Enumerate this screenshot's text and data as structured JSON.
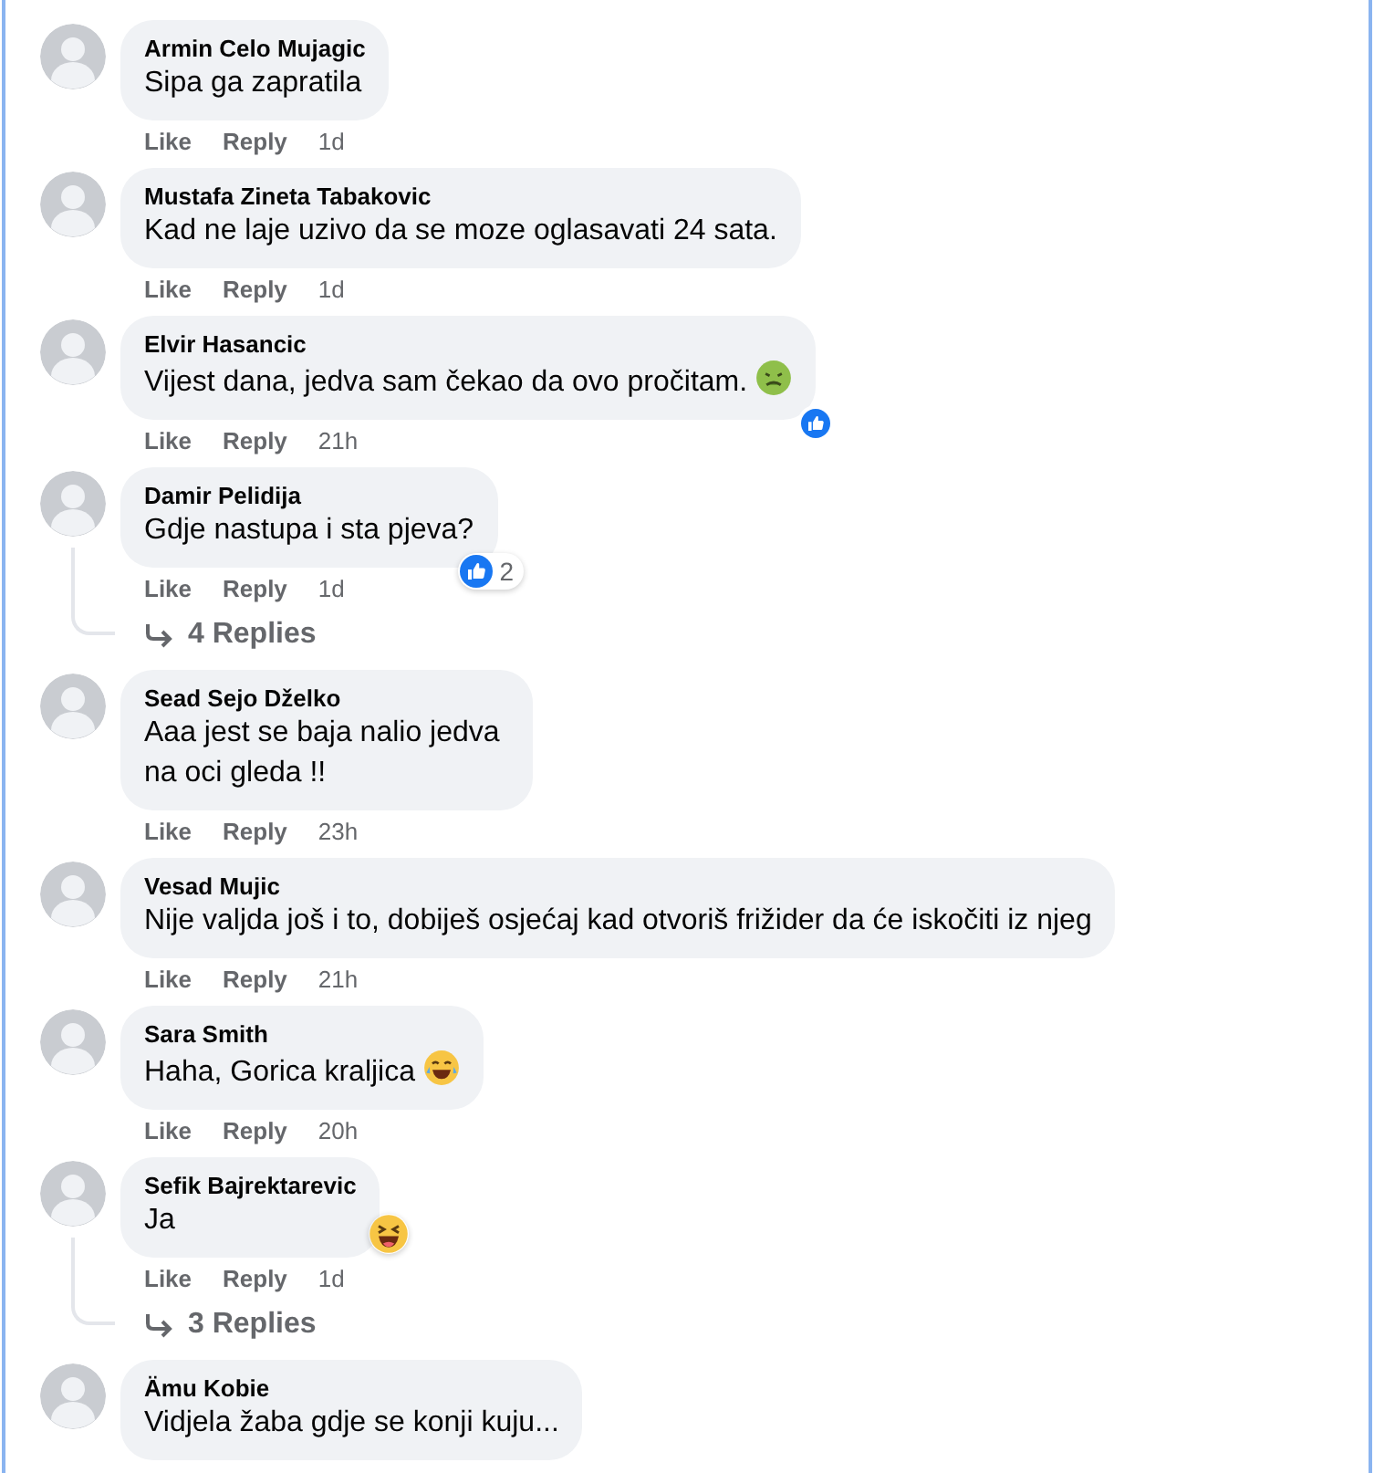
{
  "comments": [
    {
      "author": "Armin Celo Mujagic",
      "text": "Sipa ga zapratila",
      "actions": [
        "Like",
        "Reply"
      ],
      "time": "1d"
    },
    {
      "author": "Mustafa Zineta Tabakovic",
      "text": "Kad ne laje uzivo da se moze oglasavati 24 sata.",
      "actions": [
        "Like",
        "Reply"
      ],
      "time": "1d"
    },
    {
      "author": "Elvir Hasancic",
      "text": "Vijest dana, jedva sam čekao da ovo pročitam.",
      "inline_emoji": {
        "kind": "sick"
      },
      "reaction": {
        "kind": "like"
      },
      "actions": [
        "Like",
        "Reply"
      ],
      "time": "21h"
    },
    {
      "author": "Damir Pelidija",
      "text": "Gdje nastupa i sta pjeva?",
      "reaction": {
        "kind": "like",
        "count": "2"
      },
      "actions": [
        "Like",
        "Reply"
      ],
      "time": "1d",
      "replies": "4 Replies"
    },
    {
      "author": "Sead Sejo Dželko",
      "text": "Aaa jest se baja nalio jedva na oci gleda !!",
      "actions": [
        "Like",
        "Reply"
      ],
      "time": "23h"
    },
    {
      "author": "Vesad Mujic",
      "text": "Nije valjda još i to, dobiješ osjećaj kad otvoriš frižider da će iskočiti iz njeg",
      "actions": [
        "Like",
        "Reply"
      ],
      "time": "21h"
    },
    {
      "author": "Sara Smith",
      "text": "Haha, Gorica kraljica",
      "inline_emoji": {
        "kind": "laugh"
      },
      "actions": [
        "Like",
        "Reply"
      ],
      "time": "20h"
    },
    {
      "author": "Sefik Bajrektarevic",
      "text": "Ja",
      "reaction": {
        "kind": "haha"
      },
      "actions": [
        "Like",
        "Reply"
      ],
      "time": "1d",
      "replies": "3 Replies"
    },
    {
      "author": "Ämu Kobie",
      "text": "Vidjela žaba gdje se konji kuju..."
    }
  ]
}
